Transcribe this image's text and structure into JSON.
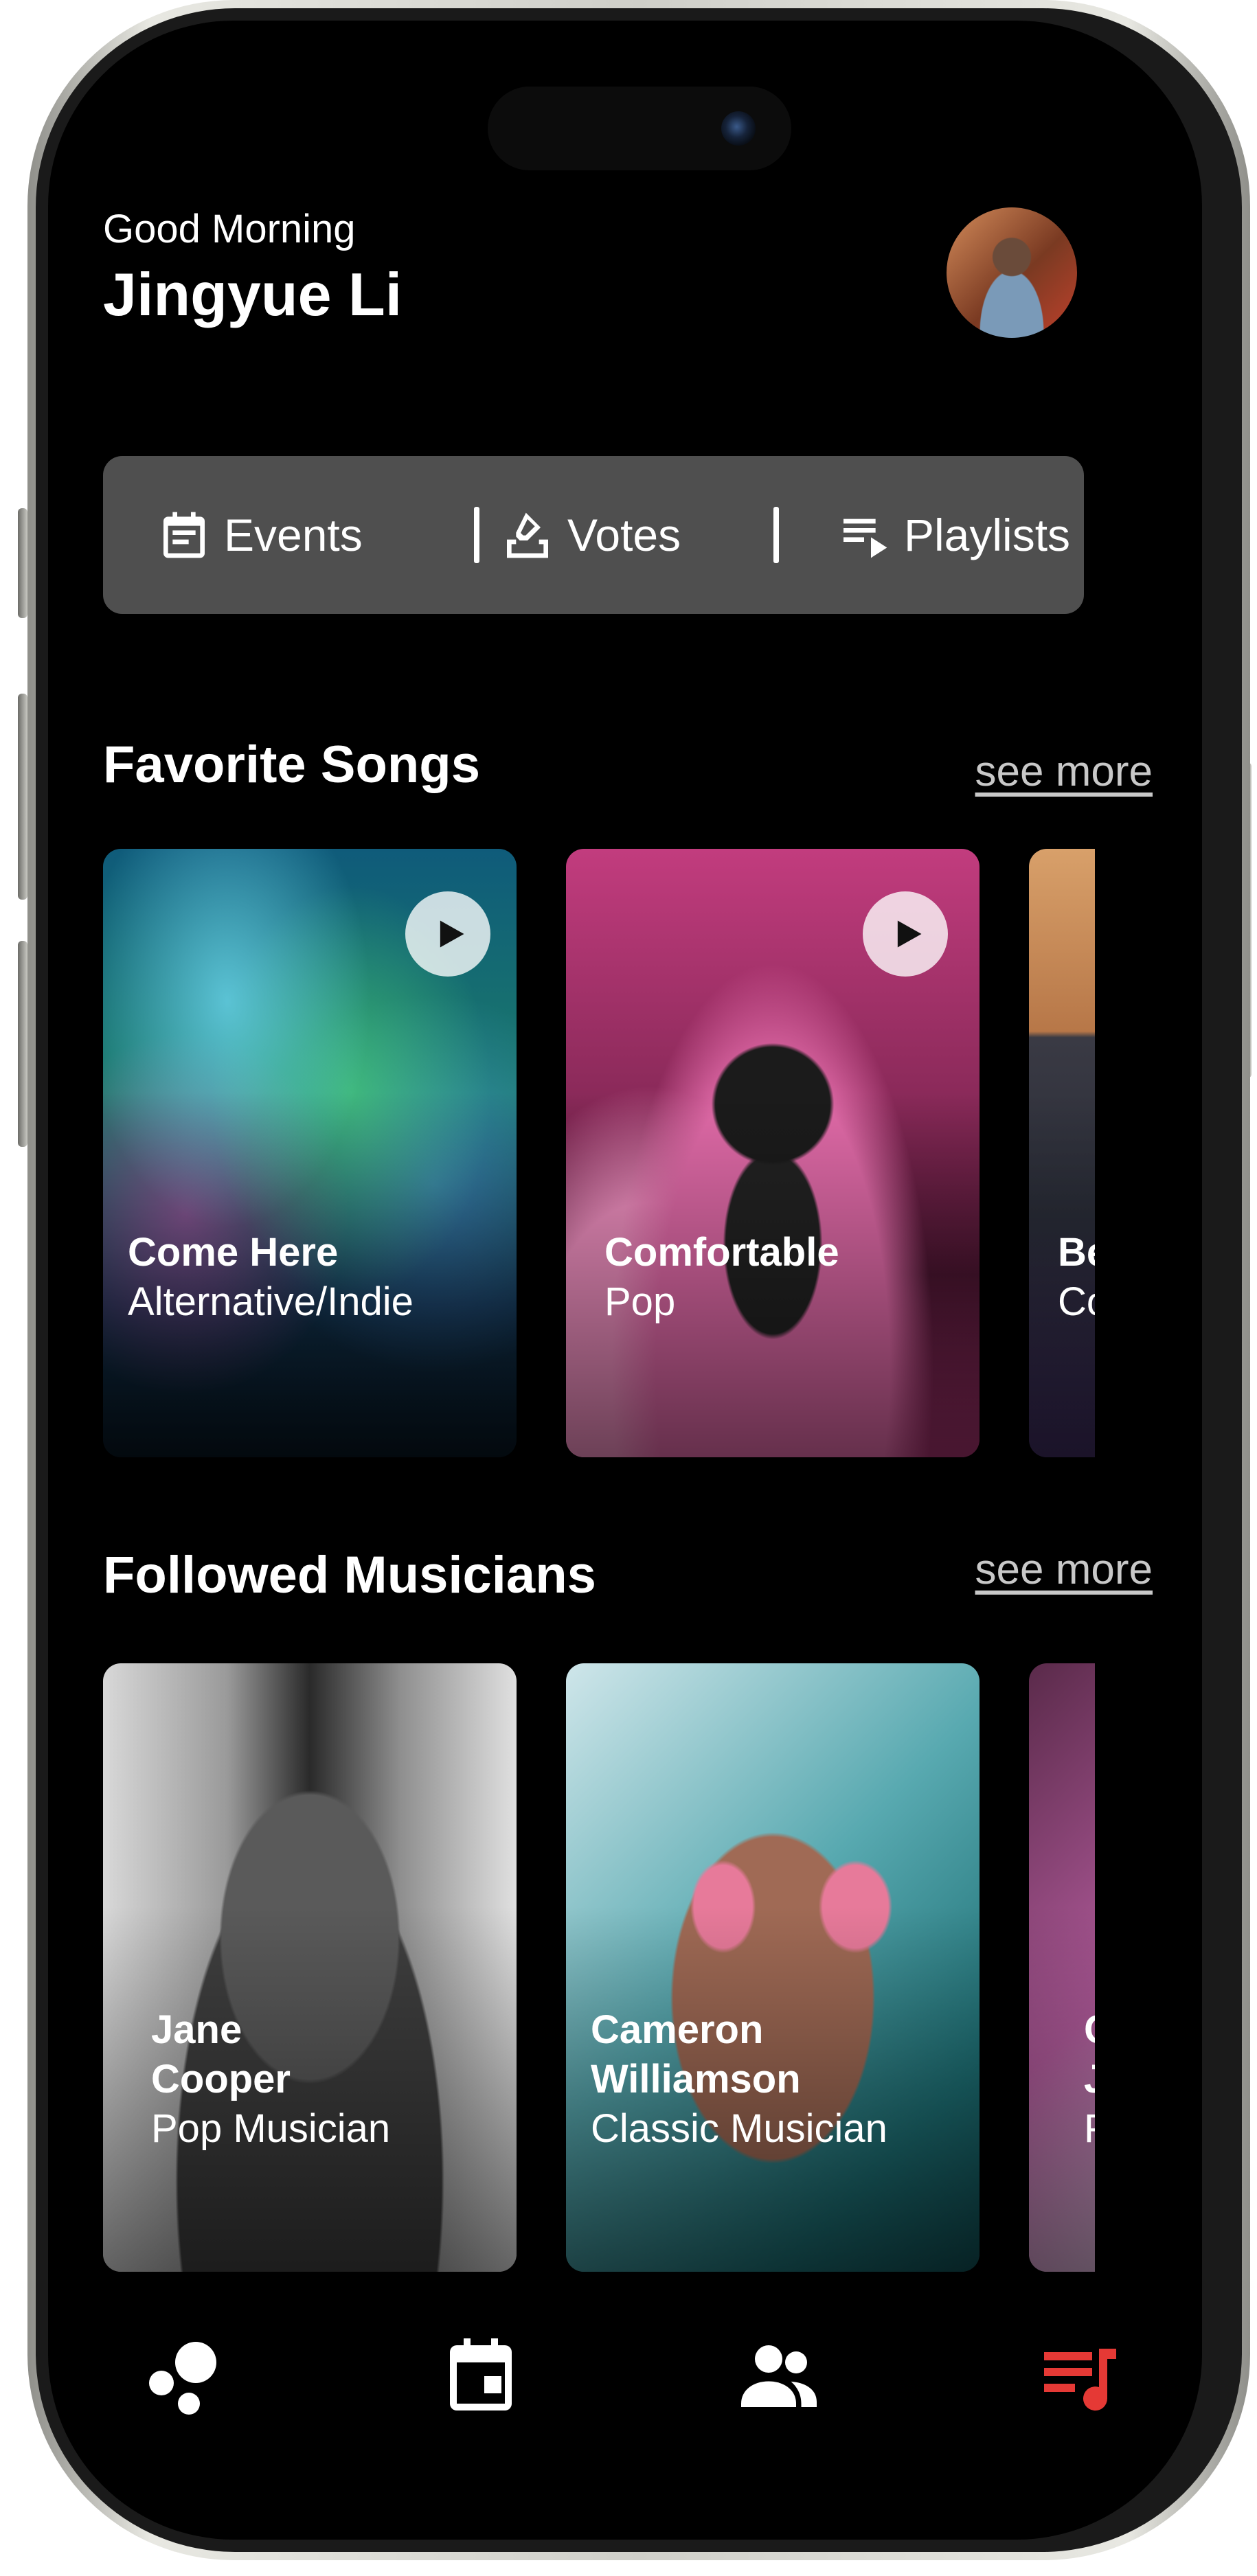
{
  "header": {
    "greeting": "Good Morning",
    "user_name": "Jingyue Li"
  },
  "segments": [
    {
      "label": "Events",
      "icon": "calendar-list-icon"
    },
    {
      "label": "Votes",
      "icon": "ballot-box-icon"
    },
    {
      "label": "Playlists",
      "icon": "playlist-play-icon"
    }
  ],
  "favorite_songs": {
    "title": "Favorite Songs",
    "see_more": "see more",
    "items": [
      {
        "title": "Come Here",
        "genre": "Alternative/Indie"
      },
      {
        "title": "Comfortable",
        "genre": "Pop"
      },
      {
        "title": "Bette",
        "genre": "Cour"
      }
    ]
  },
  "followed_musicians": {
    "title": "Followed Musicians",
    "see_more": "see more",
    "items": [
      {
        "name_line1": "Jane",
        "name_line2": "Cooper",
        "role": "Pop Musician"
      },
      {
        "name_line1": "Cameron",
        "name_line2": "Williamson",
        "role": "Classic Musician"
      },
      {
        "name_line1": "Cla",
        "name_line2": "Jan",
        "role": "Pop"
      }
    ]
  },
  "bottom_nav": {
    "tabs": [
      "discover-bubbles-icon",
      "calendar-event-icon",
      "people-icon",
      "music-queue-icon"
    ],
    "active_tab": "music-queue-icon",
    "active_color": "#e53935",
    "inactive_color": "#ffffff"
  },
  "colors": {
    "background": "#000000",
    "segment_bar": "#4f4f4f",
    "accent": "#e53935"
  }
}
